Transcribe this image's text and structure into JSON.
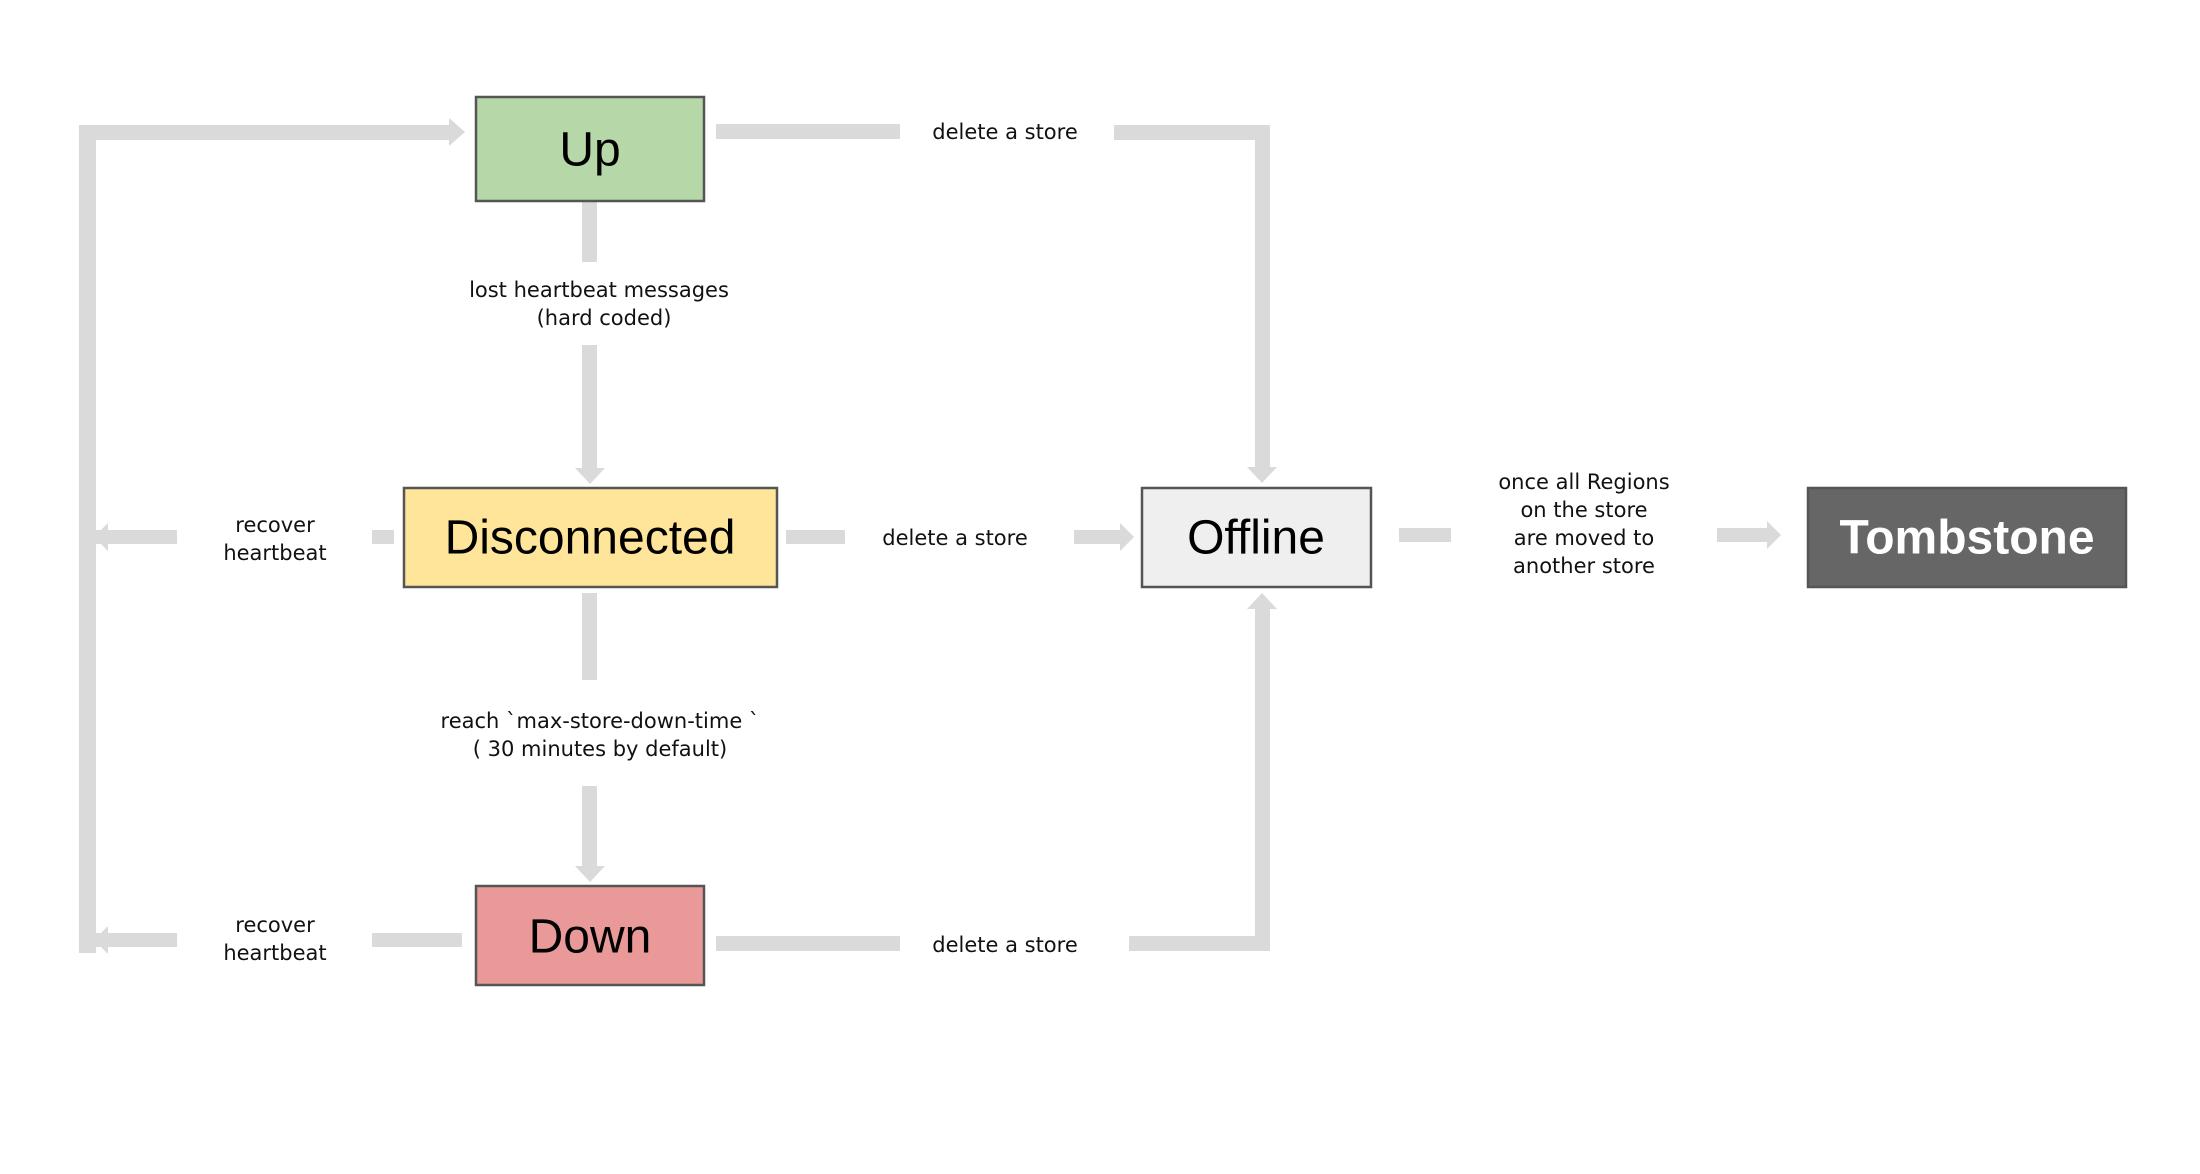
{
  "colors": {
    "connector": "#dadada",
    "up": "#b6d7a8",
    "disconnected": "#ffe599",
    "down": "#ea9999",
    "offline": "#efefef",
    "tombstone": "#666666",
    "border": "#555555"
  },
  "states": {
    "up": "Up",
    "disconnected": "Disconnected",
    "down": "Down",
    "offline": "Offline",
    "tombstone": "Tombstone"
  },
  "transitions": {
    "up_to_disconnected": [
      "lost heartbeat messages",
      "(hard coded)"
    ],
    "disconnected_to_down": [
      "reach `max-store-down-time `",
      "( 30 minutes  by default)"
    ],
    "disconnected_recover": [
      "recover",
      "heartbeat"
    ],
    "down_recover": [
      "recover",
      "heartbeat"
    ],
    "up_delete": "delete a store",
    "disconnected_delete": "delete a store",
    "down_delete": "delete a store",
    "offline_to_tombstone": [
      "once all Regions",
      "on the store",
      "are moved to",
      "another store"
    ]
  }
}
